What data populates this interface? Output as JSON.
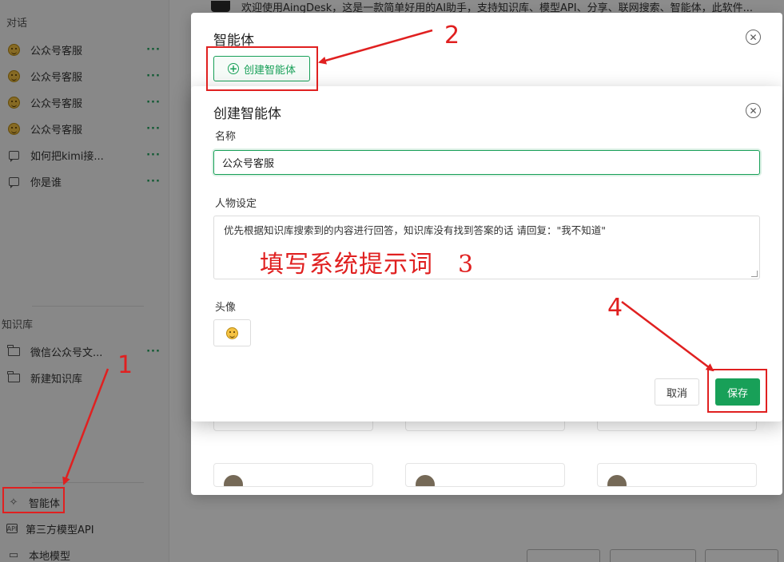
{
  "sidebar": {
    "conversations_title": "对话",
    "conversations": [
      {
        "label": "公众号客服",
        "icon": "emoji-face-icon",
        "more": "···"
      },
      {
        "label": "公众号客服",
        "icon": "emoji-face-icon",
        "more": "···"
      },
      {
        "label": "公众号客服",
        "icon": "emoji-face-icon",
        "more": "···"
      },
      {
        "label": "公众号客服",
        "icon": "emoji-face-icon",
        "more": "···"
      },
      {
        "label": "如何把kimi接...",
        "icon": "chat-icon",
        "more": "···"
      },
      {
        "label": "你是谁",
        "icon": "chat-icon",
        "more": "···"
      }
    ],
    "knowledge_title": "知识库",
    "knowledge_items": [
      {
        "label": "微信公众号文...",
        "icon": "folder-icon",
        "more": "···"
      },
      {
        "label": "新建知识库",
        "icon": "folder-plus-icon"
      }
    ],
    "bottom_nav": [
      {
        "label": "智能体",
        "icon": "sparkle-icon"
      },
      {
        "label": "第三方模型API",
        "icon": "api-icon"
      },
      {
        "label": "本地模型",
        "icon": "monitor-icon"
      }
    ]
  },
  "main": {
    "welcome_text": "欢迎使用AingDesk，这是一款简单好用的AI助手，支持知识库、模型API、分享、联网搜索、智能体，此软件..."
  },
  "agent_dialog": {
    "title": "智能体",
    "create_button": "创建智能体"
  },
  "create_dialog": {
    "title": "创建智能体",
    "name_label": "名称",
    "name_value": "公众号客服",
    "persona_label": "人物设定",
    "persona_value": "优先根据知识库搜索到的内容进行回答，知识库没有找到答案的话 请回复：\"我不知道\"",
    "avatar_label": "头像",
    "cancel": "取消",
    "save": "保存"
  },
  "annotations": {
    "step1": "1",
    "step2": "2",
    "step3_text": "填写系统提示词　3",
    "step4": "4",
    "color": "#e02020"
  },
  "colors": {
    "accent": "#18a058",
    "overlay": "rgba(0,0,0,0.45)"
  }
}
